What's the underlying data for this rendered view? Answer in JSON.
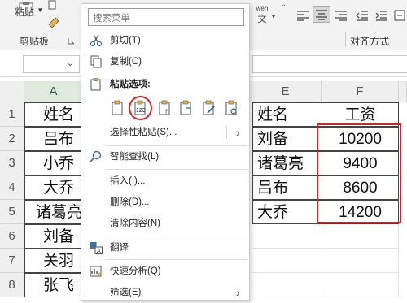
{
  "ribbon": {
    "paste_label": "粘贴",
    "clipboard_label": "剪贴板",
    "wen_label": "wén",
    "wen_sub": "文",
    "align_label": "对齐方式"
  },
  "menu": {
    "search_placeholder": "搜索菜单",
    "cut": "剪切(T)",
    "copy": "复制(C)",
    "paste_options": "粘贴选项:",
    "paste_special": "选择性粘贴(S)...",
    "smart_lookup": "智能查找(L)",
    "insert": "插入(I)...",
    "delete": "删除(D)...",
    "clear_contents": "清除内容(N)",
    "translate": "翻译",
    "quick_analysis": "快速分析(Q)",
    "filter": "筛选(E)",
    "paste_value_badge": "123",
    "submenu_arrow": "›"
  },
  "grid": {
    "columns": [
      "A",
      "E",
      "F"
    ],
    "rows": [
      "1",
      "2",
      "3",
      "4",
      "5",
      "6",
      "7",
      "8"
    ],
    "col_a": [
      "姓名",
      "吕布",
      "小乔",
      "大乔",
      "诸葛亮",
      "刘备",
      "关羽",
      "张飞"
    ],
    "col_e": [
      "姓名",
      "刘备",
      "诸葛亮",
      "吕布",
      "大乔",
      "",
      "",
      ""
    ],
    "col_f": [
      "工资",
      "10200",
      "9400",
      "8600",
      "14200",
      "",
      "",
      ""
    ]
  },
  "colors": {
    "highlight_red": "#e02020",
    "header_selected_green": "#1d6b34"
  }
}
